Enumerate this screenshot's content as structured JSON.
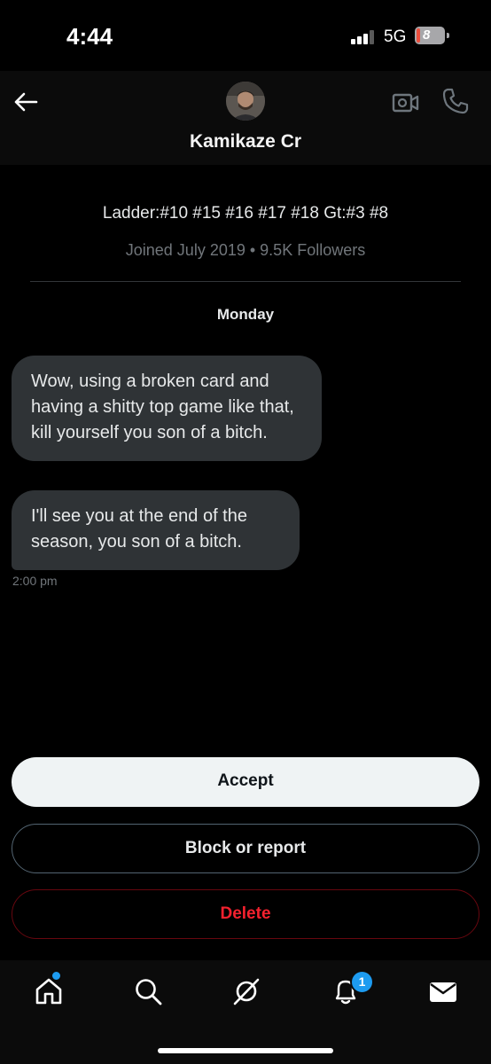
{
  "status_bar": {
    "time": "4:44",
    "network": "5G",
    "battery": "8"
  },
  "header": {
    "title": "Kamikaze Cr",
    "back_icon": "arrow-left-icon",
    "video_icon": "video-call-icon",
    "phone_icon": "phone-icon"
  },
  "profile": {
    "bio": "Ladder:#10 #15 #16 #17 #18 Gt:#3 #8",
    "meta": "Joined July 2019 • 9.5K Followers"
  },
  "conversation": {
    "day_label": "Monday",
    "messages": [
      {
        "text": "Wow, using a broken card and having a shitty top game like that, kill yourself you son of a bitch."
      },
      {
        "text": "I'll see you at the end of the season, you son of a bitch."
      }
    ],
    "timestamp": "2:00 pm"
  },
  "actions": {
    "accept_label": "Accept",
    "block_label": "Block or report",
    "delete_label": "Delete"
  },
  "bottom_nav": {
    "items": [
      {
        "icon": "home-icon"
      },
      {
        "icon": "search-icon"
      },
      {
        "icon": "grok-icon"
      },
      {
        "icon": "notifications-icon"
      },
      {
        "icon": "messages-icon"
      }
    ],
    "notification_count": "1"
  },
  "colors": {
    "background": "#000000",
    "bubble": "#2f3336",
    "accent": "#1d9bf0",
    "delete": "#f4212e",
    "battery_low": "#eb4e3d"
  }
}
